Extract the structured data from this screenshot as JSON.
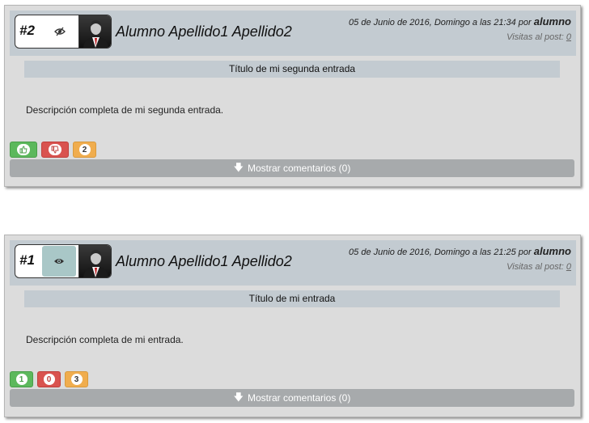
{
  "posts": [
    {
      "number": "#2",
      "visibility_icon": "eye-slash-icon",
      "author": "Alumno Apellido1 Apellido2",
      "date_text": "05 de Junio de 2016, Domingo a las 21:34 por ",
      "user": "alumno",
      "visits_label": "Visitas al post:",
      "visits_count": "0",
      "title": "Título de mi segunda entrada",
      "description": "Descripción completa de mi segunda entrada.",
      "likes": "",
      "dislikes": "",
      "views": "2",
      "comments_label": "Mostrar comentarios (0)"
    },
    {
      "number": "#1",
      "visibility_icon": "eye-icon",
      "author": "Alumno Apellido1 Apellido2",
      "date_text": "05 de Junio de 2016, Domingo a las 21:25 por ",
      "user": "alumno",
      "visits_label": "Visitas al post:",
      "visits_count": "0",
      "title": "Título de mi entrada",
      "description": "Descripción completa de mi entrada.",
      "likes": "1",
      "dislikes": "0",
      "views": "3",
      "comments_label": "Mostrar comentarios (0)"
    }
  ],
  "colors": {
    "like": "#5cb85c",
    "dislike": "#d9534f",
    "views": "#f0ad4e",
    "header": "#c3cbd1",
    "comments_bar": "#a7aaac"
  }
}
